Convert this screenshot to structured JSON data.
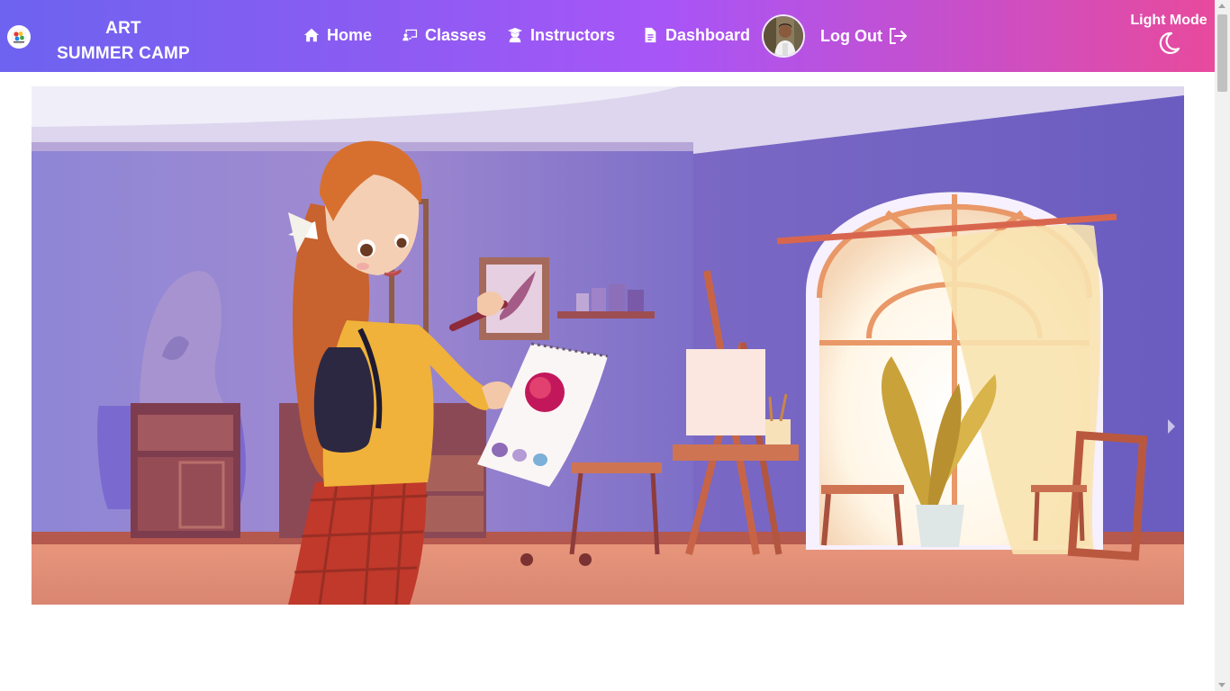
{
  "brand": {
    "line1": "ART",
    "line2": "SUMMER CAMP",
    "logo_icon": "palette-logo-icon"
  },
  "nav": [
    {
      "label": "Home",
      "icon": "home-icon"
    },
    {
      "label": "Classes",
      "icon": "chalkboard-icon"
    },
    {
      "label": "Instructors",
      "icon": "user-graduate-icon"
    },
    {
      "label": "Dashboard",
      "icon": "document-icon"
    }
  ],
  "user": {
    "avatar_icon": "user-avatar"
  },
  "logout": {
    "label": "Log Out",
    "icon": "logout-icon"
  },
  "theme": {
    "label": "Light Mode",
    "icon": "moon-icon"
  },
  "hero": {
    "image_icon": "art-studio-illustration",
    "next_icon": "chevron-right-icon"
  },
  "colors": {
    "nav_start": "#6d63f0",
    "nav_mid": "#a855f7",
    "nav_end": "#e84a9c",
    "text": "#ffffff"
  }
}
